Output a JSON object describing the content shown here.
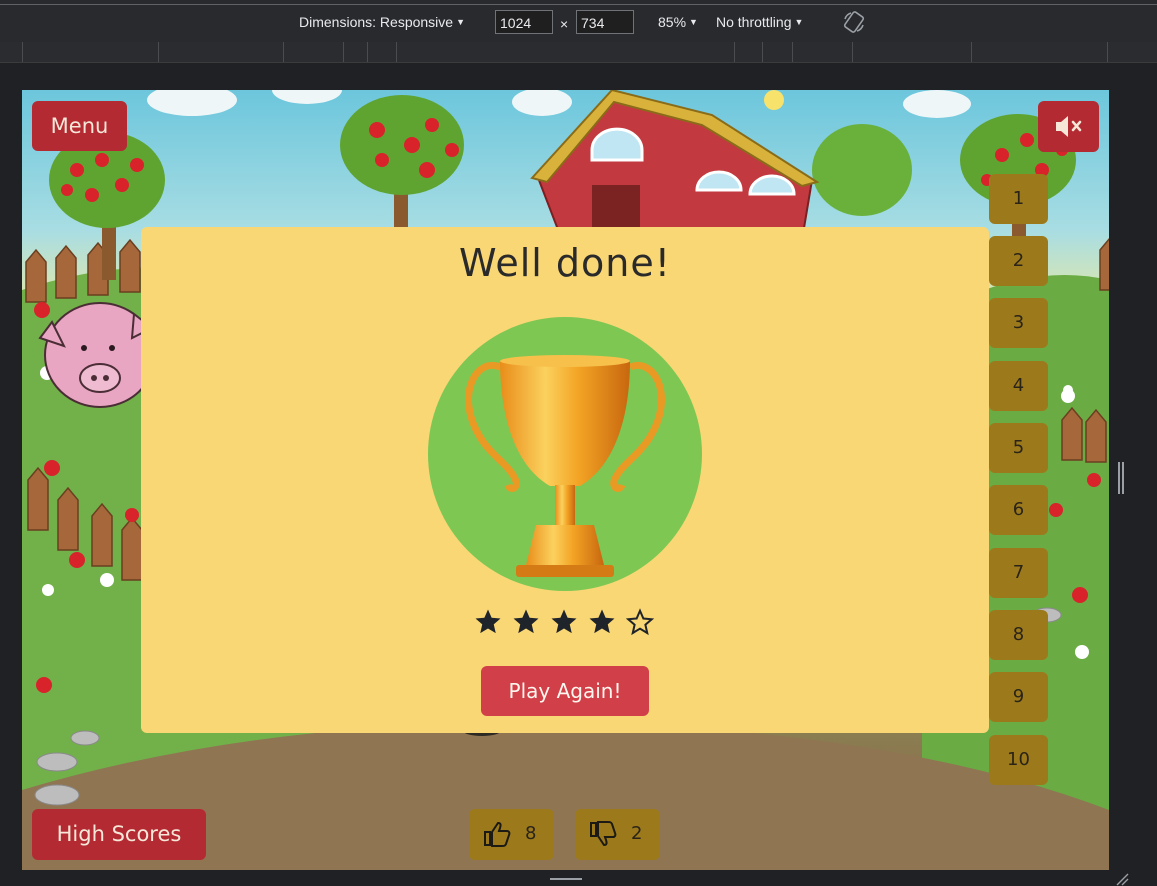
{
  "devtools": {
    "dimensions_label": "Dimensions: Responsive",
    "width_value": "1024",
    "times": "×",
    "height_value": "734",
    "zoom": "85%",
    "throttling": "No throttling"
  },
  "game": {
    "menu_label": "Menu",
    "high_scores_label": "High Scores",
    "mute_icon": "speaker-muted-icon",
    "levels": [
      "1",
      "2",
      "3",
      "4",
      "5",
      "6",
      "7",
      "8",
      "9",
      "10"
    ],
    "likes": "8",
    "dislikes": "2"
  },
  "modal": {
    "title": "Well done!",
    "trophy_icon": "trophy-icon",
    "rating": 4,
    "rating_max": 5,
    "play_again_label": "Play Again!"
  },
  "colors": {
    "button_red": "#b42a32",
    "modal_bg": "#f9d774",
    "play_button": "#d13f48",
    "trophy_circle": "#7ec753",
    "level_tile": "#9c7a1c"
  }
}
